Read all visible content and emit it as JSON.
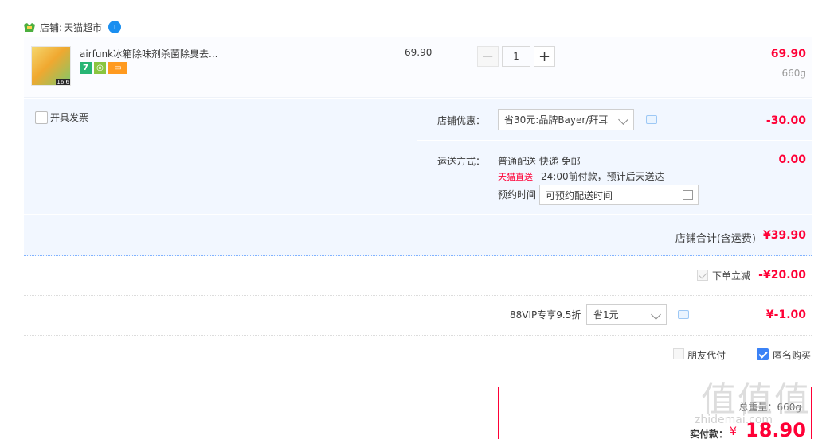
{
  "shop": {
    "label": "店铺:",
    "name": "天猫超市",
    "chat_badge": "1"
  },
  "item": {
    "title": "airfunk冰箱除味剂杀菌除臭去...",
    "thumb_tag": "16.6",
    "unit_price": "69.90",
    "quantity": "1",
    "subtotal": "69.90",
    "weight": "660g",
    "icons": [
      "seven-day-return-icon",
      "guarantee-badge-icon",
      "card-pay-icon"
    ]
  },
  "options": {
    "invoice_label": "开具发票",
    "promo_label": "店铺优惠：",
    "promo_selected": "省30元:品牌Bayer/拜耳",
    "promo_amount": "-30.00",
    "ship_label": "运送方式：",
    "ship_methods": "普通配送 快递 免邮",
    "tmall_logo": "天猫直送",
    "delivery_note": "24:00前付款，预计后天送达",
    "appoint_label": "预约时间",
    "appoint_placeholder": "可预约配送时间",
    "ship_amount": "0.00"
  },
  "shop_total": {
    "label": "店铺合计(含运费)",
    "amount": "¥39.90"
  },
  "instant_discount": {
    "label": "下单立减",
    "amount": "-¥20.00"
  },
  "vip": {
    "label": "88VIP专享9.5折",
    "selected": "省1元",
    "amount": "¥-1.00"
  },
  "pay_options": {
    "friend_pay": "朋友代付",
    "anonymous": "匿名购买"
  },
  "payment": {
    "weight": "总重量：660g",
    "label": "实付款：",
    "currency": "¥",
    "amount": "18.90"
  },
  "watermark": {
    "main": "值值值",
    "sub": "zhidemai.com"
  },
  "colors": {
    "accent_red": "#ff0036",
    "panel_blue": "#f2f7ff",
    "check_blue": "#3b82f6"
  }
}
